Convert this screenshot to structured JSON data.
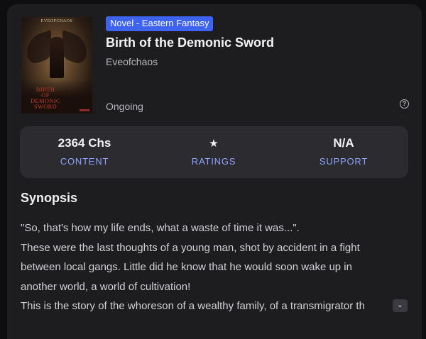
{
  "book": {
    "cover": {
      "author_print": "EVEOFCHAOS",
      "title_lines": [
        "BIRTH",
        "OF",
        "DEMONIC",
        "SWORD"
      ]
    },
    "genre": "Novel - Eastern Fantasy",
    "title": "Birth of the Demonic Sword",
    "author": "Eveofchaos",
    "status": "Ongoing"
  },
  "help": {
    "icon": "question-circle-icon",
    "glyph": "?"
  },
  "stats": {
    "content": {
      "value": "2364 Chs",
      "label": "CONTENT"
    },
    "ratings": {
      "icon": "star-icon",
      "glyph": "★",
      "label": "RATINGS"
    },
    "support": {
      "value": "N/A",
      "label": "SUPPORT"
    }
  },
  "synopsis": {
    "heading": "Synopsis",
    "lines": [
      "\"So, that's how my life ends, what a waste of time it was...\".",
      "These were the last thoughts of a young man, shot by accident in a fight",
      "between local gangs. Little did he know that he would soon wake up in",
      "another world, a world of cultivation!",
      "This is the story of the whoreson of a wealthy family, of a transmigrator th"
    ],
    "expand_icon": "chevron-down-icon",
    "expand_glyph": "⌄"
  },
  "colors": {
    "accent": "#3d63f0",
    "link": "#8ea2ff",
    "card_bg": "#1d1d20",
    "stats_bg": "#2b2b30"
  }
}
